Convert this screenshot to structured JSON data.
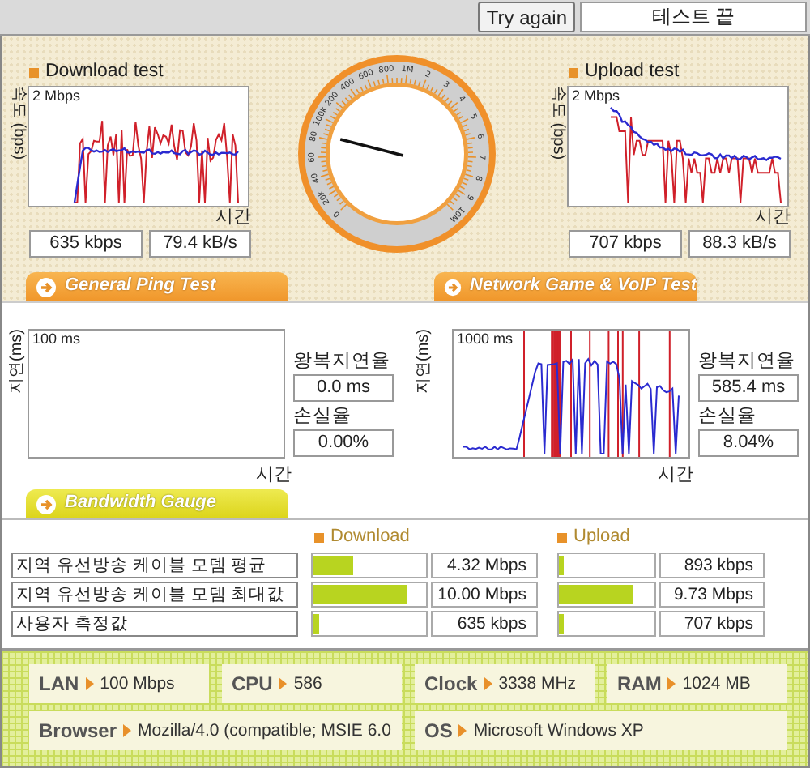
{
  "toolbar": {
    "retry_button": "Try again",
    "status": "테스트 끝"
  },
  "speed_tests": [
    {
      "title": "Download test",
      "axis_label": "속도 (bps)",
      "scale_label": "2 Mbps",
      "time_label": "시간",
      "rate_bits": "635 kbps",
      "rate_bytes": "79.4 kB/s"
    },
    {
      "title": "Upload test",
      "axis_label": "속도 (bps)",
      "scale_label": "2 Mbps",
      "time_label": "시간",
      "rate_bits": "707 kbps",
      "rate_bytes": "88.3 kB/s"
    }
  ],
  "speed_gauge": {
    "labels": [
      "0",
      "20k",
      "40",
      "60",
      "80",
      "100k",
      "200",
      "400",
      "600",
      "800",
      "1M",
      "2",
      "3",
      "4",
      "5",
      "6",
      "7",
      "8",
      "9",
      "10M"
    ]
  },
  "ping_panels": [
    {
      "tab": "General Ping Test",
      "kind": "blank",
      "axis_label": "지연(ms)",
      "scale_label": "100 ms",
      "time_label": "시간",
      "latency_label": "왕복지연율",
      "latency": "0.0 ms",
      "loss_label": "손실율",
      "loss": "0.00%"
    },
    {
      "tab": "Network Game & VoIP Test",
      "kind": "trace",
      "axis_label": "지연(ms)",
      "scale_label": "1000 ms",
      "time_label": "시간",
      "latency_label": "왕복지연율",
      "latency": "585.4 ms",
      "loss_label": "손실율",
      "loss": "8.04%"
    }
  ],
  "bandwidth": {
    "tab": "Bandwidth Gauge",
    "headers": [
      "Download",
      "Upload"
    ],
    "rows": [
      {
        "label": "지역 유선방송 케이블 모뎀 평균",
        "download": {
          "level": 0.35,
          "value": "4.32 Mbps"
        },
        "upload": {
          "level": 0.05,
          "value": "893 kbps"
        }
      },
      {
        "label": "지역 유선방송 케이블 모뎀 최대값",
        "download": {
          "level": 0.83,
          "value": "10.00 Mbps"
        },
        "upload": {
          "level": 0.78,
          "value": "9.73 Mbps"
        }
      },
      {
        "label": "사용자 측정값",
        "download": {
          "level": 0.05,
          "value": "635 kbps"
        },
        "upload": {
          "level": 0.05,
          "value": "707 kbps"
        }
      }
    ]
  },
  "system_info": [
    {
      "label": "LAN",
      "value": "100 Mbps"
    },
    {
      "label": "CPU",
      "value": "586"
    },
    {
      "label": "Clock",
      "value": "3338 MHz"
    },
    {
      "label": "RAM",
      "value": "1024 MB"
    },
    {
      "label": "Browser",
      "value": "Mozilla/4.0 (compatible; MSIE 6.0"
    },
    {
      "label": "OS",
      "value": "Microsoft Windows XP"
    }
  ]
}
